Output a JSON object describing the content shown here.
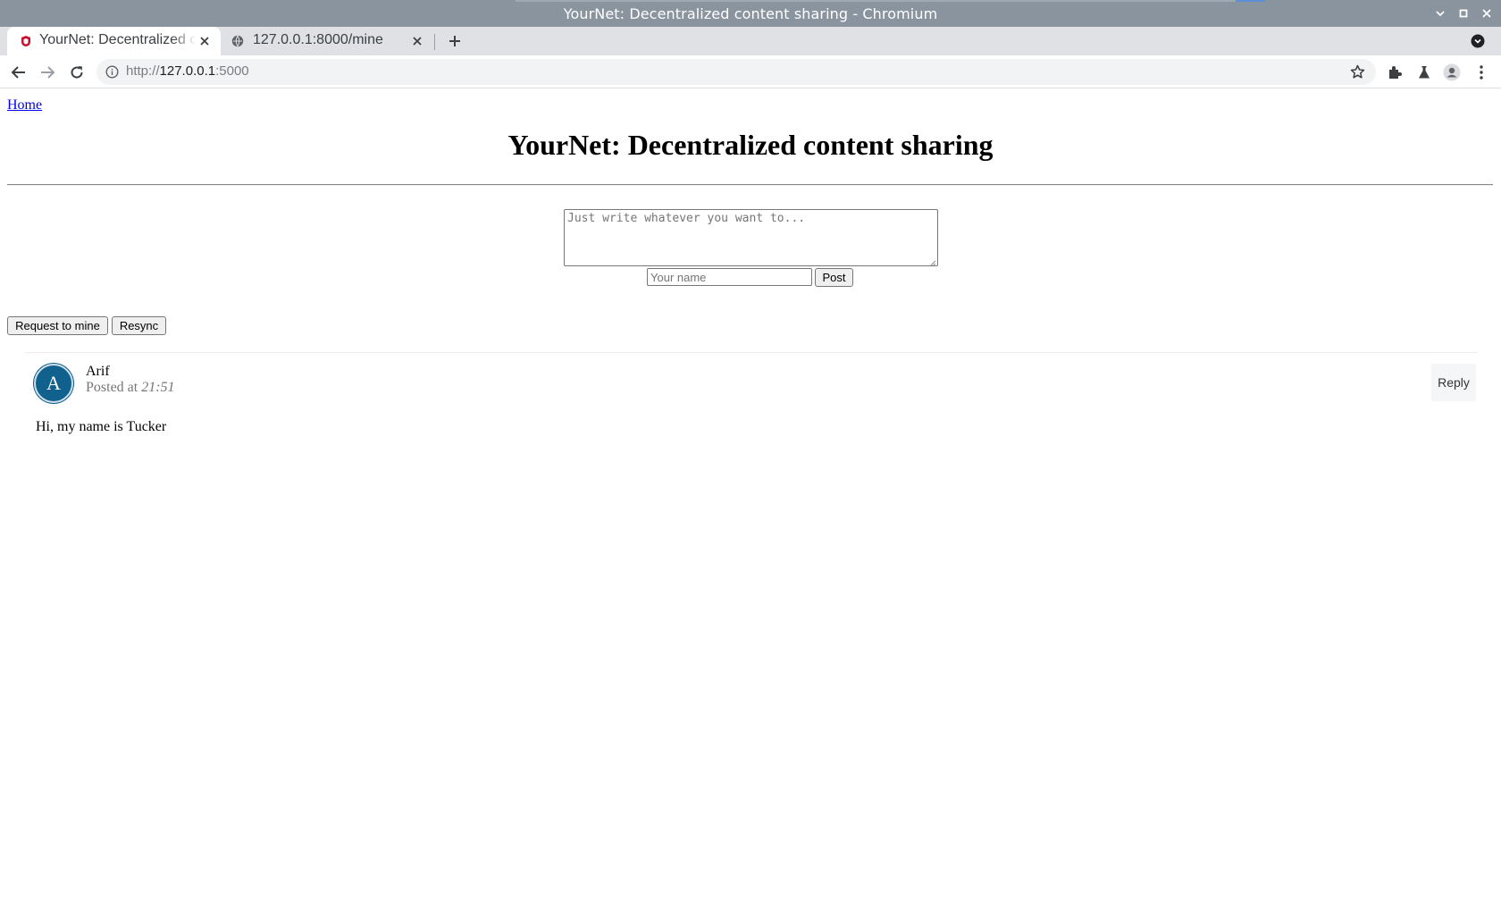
{
  "window": {
    "title": "YourNet: Decentralized content sharing - Chromium"
  },
  "tabs": [
    {
      "title": "YourNet: Decentralized co",
      "favicon": "yournet-favicon",
      "active": true
    },
    {
      "title": "127.0.0.1:8000/mine",
      "favicon": "globe-icon",
      "active": false
    }
  ],
  "toolbar": {
    "url_prefix": "http://",
    "url_host": "127.0.0.1",
    "url_suffix": ":5000"
  },
  "page": {
    "home_link": "Home",
    "title": "YourNet: Decentralized content sharing",
    "compose": {
      "textarea_placeholder": "Just write whatever you want to...",
      "name_placeholder": "Your name",
      "post_label": "Post"
    },
    "actions": {
      "request_label": "Request to mine",
      "resync_label": "Resync"
    },
    "posts": [
      {
        "avatar_letter": "A",
        "author": "Arif",
        "posted_prefix": "Posted at ",
        "time": "21:51",
        "reply_label": "Reply",
        "body": "Hi, my name is Tucker"
      }
    ]
  },
  "colors": {
    "titlebar": "#8a949e",
    "avatar": "#10618e",
    "link": "#0000ee"
  }
}
